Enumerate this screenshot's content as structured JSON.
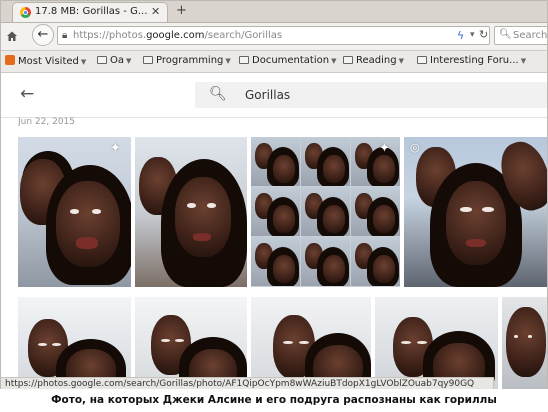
{
  "browser": {
    "tab_title": "17.8 MB: Gorillas - G...",
    "tab_close": "✕",
    "new_tab": "+",
    "url_prefix": "https://photos.",
    "url_domain": "google.com",
    "url_path": "/search/Gorillas",
    "search_placeholder": "Search",
    "back_glyph": "←"
  },
  "bookmarks": [
    {
      "label": "Most Visited",
      "type": "special"
    },
    {
      "label": "Oa",
      "type": "folder"
    },
    {
      "label": "Programming",
      "type": "folder"
    },
    {
      "label": "Documentation",
      "type": "folder"
    },
    {
      "label": "Reading",
      "type": "folder"
    },
    {
      "label": "Interesting Foru...",
      "type": "folder"
    }
  ],
  "app": {
    "back_glyph": "←",
    "search_query": "Gorillas",
    "date_header": "Jun 22, 2015"
  },
  "status_bar": {
    "link_url": "https://photos.google.com/search/Gorillas/photo/AF1QipOcYpm8wWAziuBTdopX1gLVOblZOuab7qy90GQ"
  },
  "caption": "Фото, на которых Джеки Алсине и его подруга распознаны как гориллы",
  "colors": {
    "chrome_bg": "#f2f1ef",
    "tabstrip_bg": "#d9d5ce",
    "link_blue": "#2b6ed3"
  }
}
